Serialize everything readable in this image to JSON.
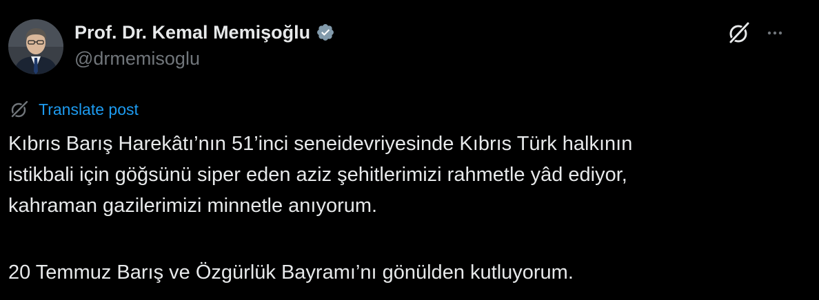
{
  "author": {
    "display_name": "Prof. Dr. Kemal Memişoğlu",
    "handle": "@drmemisoglu",
    "verified": true,
    "verified_badge_color": "#829aab"
  },
  "header_actions": {
    "grok_icon": "grok-slash-circle-icon",
    "more_icon": "more-horizontal-icon"
  },
  "translate": {
    "label": "Translate post",
    "icon": "translate-slash-circle-icon",
    "color": "#1d9bf0"
  },
  "post": {
    "paragraph1_lines": [
      "Kıbrıs Barış Harekâtı’nın 51’inci seneidevriyesinde Kıbrıs Türk halkının",
      "istikbali için göğsünü siper eden aziz şehitlerimizi rahmetle yâd ediyor,",
      "kahraman gazilerimizi minnetle anıyorum."
    ],
    "paragraph2_lines": [
      "20 Temmuz Barış ve Özgürlük Bayramı’nı gönülden kutluyorum."
    ]
  },
  "colors": {
    "background": "#000000",
    "text_primary": "#e7e9ea",
    "text_secondary": "#71767b",
    "link": "#1d9bf0"
  }
}
